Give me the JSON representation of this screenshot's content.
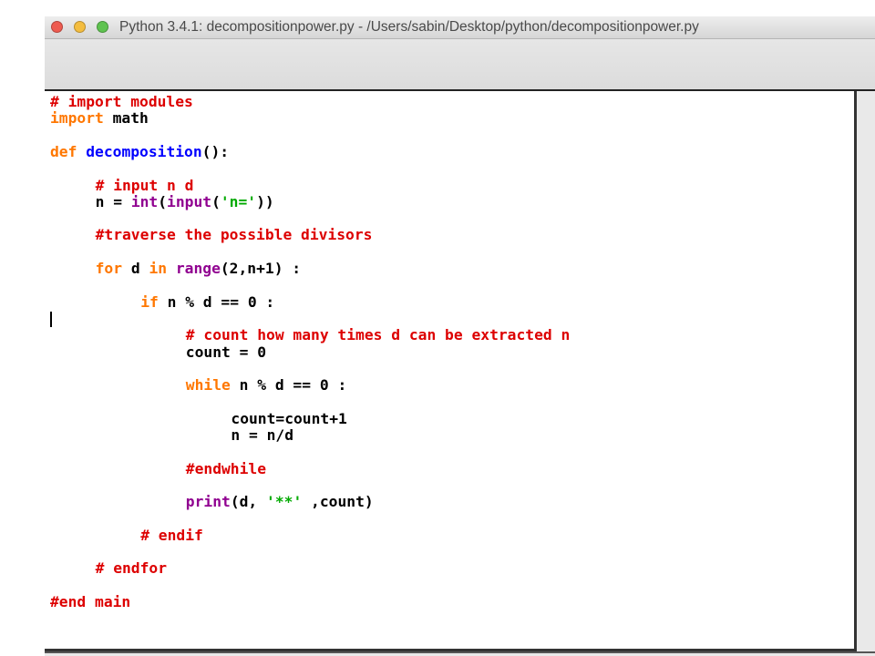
{
  "window": {
    "title": "Python 3.4.1: decompositionpower.py - /Users/sabin/Desktop/python/decompositionpower.py"
  },
  "colors": {
    "comment": "#dd0000",
    "keyword": "#ff7700",
    "builtin": "#900090",
    "definition": "#0000ff",
    "string": "#00aa00",
    "text": "#000000"
  },
  "editor": {
    "lines": [
      {
        "indent": 0,
        "tokens": [
          {
            "type": "comment",
            "text": "# import modules"
          }
        ]
      },
      {
        "indent": 0,
        "tokens": [
          {
            "type": "keyword",
            "text": "import"
          },
          {
            "type": "text",
            "text": " math"
          }
        ]
      },
      {
        "indent": 0,
        "tokens": []
      },
      {
        "indent": 0,
        "tokens": [
          {
            "type": "keyword",
            "text": "def"
          },
          {
            "type": "text",
            "text": " "
          },
          {
            "type": "definition",
            "text": "decomposition"
          },
          {
            "type": "text",
            "text": "():"
          }
        ]
      },
      {
        "indent": 0,
        "tokens": []
      },
      {
        "indent": 4,
        "tokens": [
          {
            "type": "comment",
            "text": "# input n d"
          }
        ]
      },
      {
        "indent": 4,
        "tokens": [
          {
            "type": "text",
            "text": "n = "
          },
          {
            "type": "builtin",
            "text": "int"
          },
          {
            "type": "text",
            "text": "("
          },
          {
            "type": "builtin",
            "text": "input"
          },
          {
            "type": "text",
            "text": "("
          },
          {
            "type": "string",
            "text": "'n='"
          },
          {
            "type": "text",
            "text": "))"
          }
        ]
      },
      {
        "indent": 0,
        "tokens": []
      },
      {
        "indent": 4,
        "tokens": [
          {
            "type": "comment",
            "text": "#traverse the possible divisors"
          }
        ]
      },
      {
        "indent": 0,
        "tokens": []
      },
      {
        "indent": 4,
        "tokens": [
          {
            "type": "keyword",
            "text": "for"
          },
          {
            "type": "text",
            "text": " d "
          },
          {
            "type": "keyword",
            "text": "in"
          },
          {
            "type": "text",
            "text": " "
          },
          {
            "type": "builtin",
            "text": "range"
          },
          {
            "type": "text",
            "text": "(2,n+1) :"
          }
        ]
      },
      {
        "indent": 0,
        "tokens": []
      },
      {
        "indent": 8,
        "tokens": [
          {
            "type": "keyword",
            "text": "if"
          },
          {
            "type": "text",
            "text": " n % d == 0 :"
          }
        ]
      },
      {
        "indent": 0,
        "tokens": []
      },
      {
        "indent": 12,
        "tokens": [
          {
            "type": "comment",
            "text": "# count how many times d can be extracted n"
          }
        ]
      },
      {
        "indent": 12,
        "tokens": [
          {
            "type": "text",
            "text": "count = 0"
          }
        ]
      },
      {
        "indent": 0,
        "tokens": []
      },
      {
        "indent": 12,
        "tokens": [
          {
            "type": "keyword",
            "text": "while"
          },
          {
            "type": "text",
            "text": " n % d == 0 :"
          }
        ]
      },
      {
        "indent": 0,
        "tokens": []
      },
      {
        "indent": 16,
        "tokens": [
          {
            "type": "text",
            "text": "count=count+1"
          }
        ]
      },
      {
        "indent": 16,
        "tokens": [
          {
            "type": "text",
            "text": "n = n/d"
          }
        ]
      },
      {
        "indent": 0,
        "tokens": []
      },
      {
        "indent": 12,
        "tokens": [
          {
            "type": "comment",
            "text": "#endwhile"
          }
        ]
      },
      {
        "indent": 0,
        "tokens": []
      },
      {
        "indent": 12,
        "tokens": [
          {
            "type": "builtin",
            "text": "print"
          },
          {
            "type": "text",
            "text": "(d, "
          },
          {
            "type": "string",
            "text": "'**'"
          },
          {
            "type": "text",
            "text": " ,count)"
          }
        ]
      },
      {
        "indent": 0,
        "tokens": []
      },
      {
        "indent": 8,
        "tokens": [
          {
            "type": "comment",
            "text": "# endif"
          }
        ]
      },
      {
        "indent": 0,
        "tokens": []
      },
      {
        "indent": 4,
        "tokens": [
          {
            "type": "comment",
            "text": "# endfor"
          }
        ]
      },
      {
        "indent": 0,
        "tokens": []
      },
      {
        "indent": 0,
        "tokens": [
          {
            "type": "comment",
            "text": "#end main"
          }
        ]
      }
    ]
  }
}
